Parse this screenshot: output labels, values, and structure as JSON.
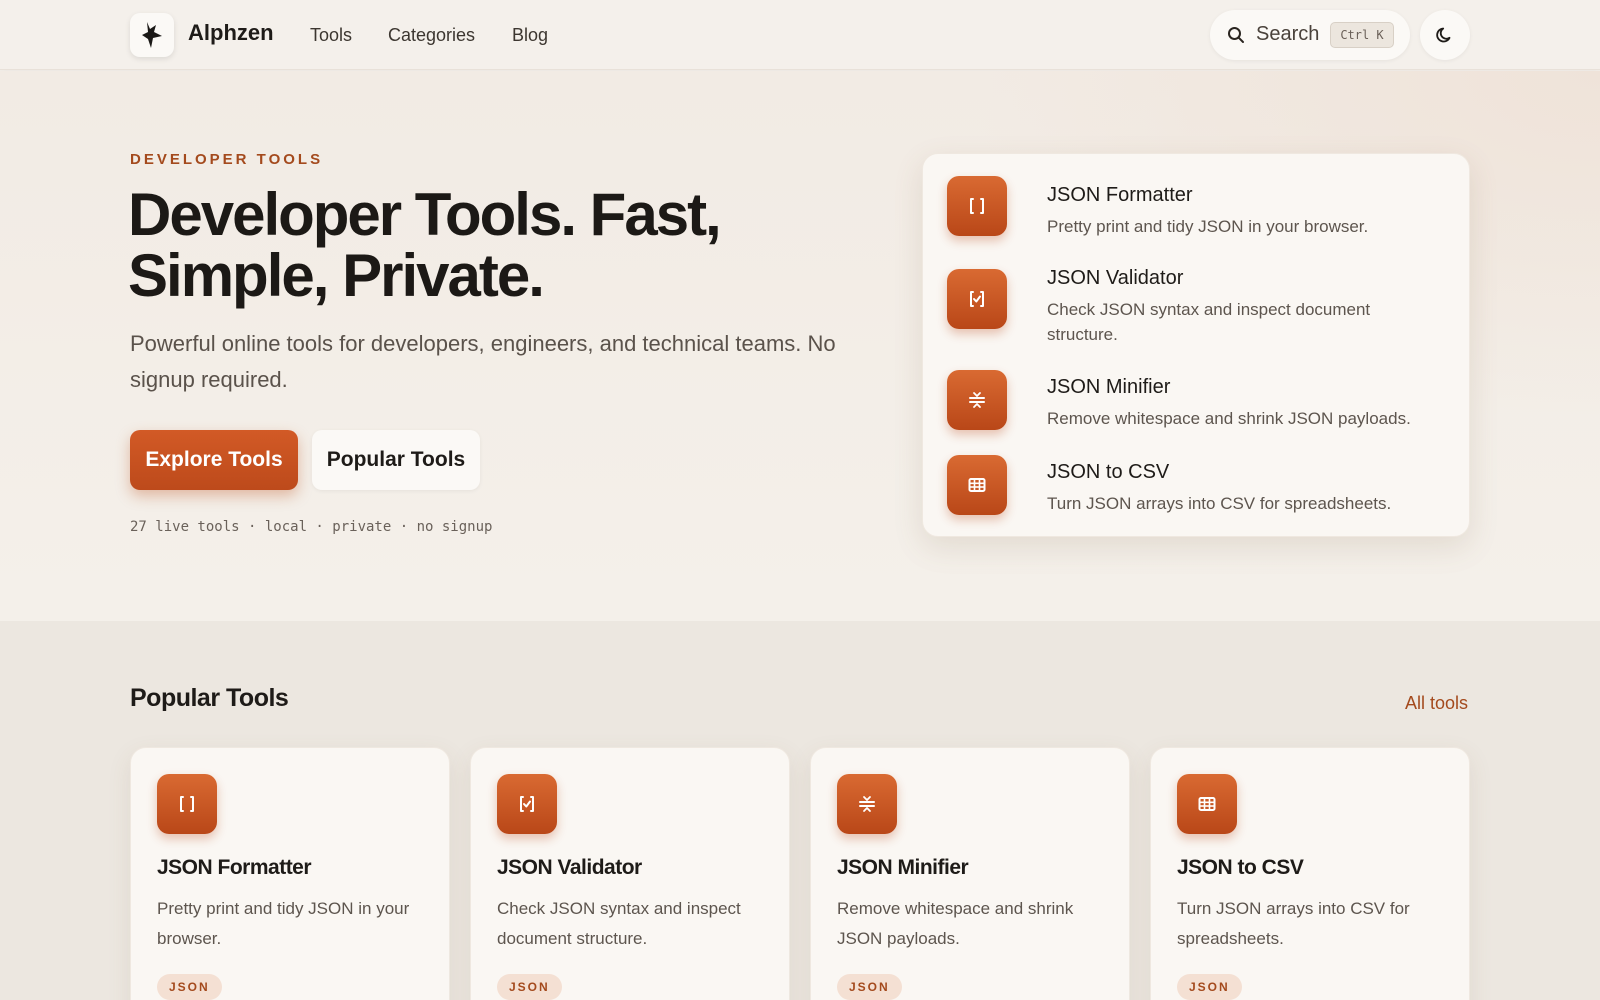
{
  "header": {
    "brand": "Alphzen",
    "nav": [
      "Tools",
      "Categories",
      "Blog"
    ],
    "search_label": "Search",
    "search_shortcut": "Ctrl K"
  },
  "hero": {
    "eyebrow": "DEVELOPER TOOLS",
    "headline_line1": "Developer Tools. Fast,",
    "headline_line2": "Simple, Private.",
    "subcopy": "Powerful online tools for developers, engineers, and technical teams. No signup required.",
    "primary_cta": "Explore Tools",
    "secondary_cta": "Popular Tools",
    "meta": "27 live tools · local · private · no signup"
  },
  "featured_tools": [
    {
      "title": "JSON Formatter",
      "description": "Pretty print and tidy JSON in your browser.",
      "icon": "brackets-icon"
    },
    {
      "title": "JSON Validator",
      "description": "Check JSON syntax and inspect document structure.",
      "icon": "check-icon"
    },
    {
      "title": "JSON Minifier",
      "description": "Remove whitespace and shrink JSON payloads.",
      "icon": "compress-icon"
    },
    {
      "title": "JSON to CSV",
      "description": "Turn JSON arrays into CSV for spreadsheets.",
      "icon": "table-icon"
    }
  ],
  "popular": {
    "title": "Popular Tools",
    "all_link": "All tools",
    "cards": [
      {
        "title": "JSON Formatter",
        "description": "Pretty print and tidy JSON in your browser.",
        "tag": "JSON",
        "icon": "brackets-icon"
      },
      {
        "title": "JSON Validator",
        "description": "Check JSON syntax and inspect document structure.",
        "tag": "JSON",
        "icon": "check-icon"
      },
      {
        "title": "JSON Minifier",
        "description": "Remove whitespace and shrink JSON payloads.",
        "tag": "JSON",
        "icon": "compress-icon"
      },
      {
        "title": "JSON to CSV",
        "description": "Turn JSON arrays into CSV for spreadsheets.",
        "tag": "JSON",
        "icon": "table-icon"
      }
    ]
  },
  "colors": {
    "accent": "#c4511f",
    "accent_text": "#a44a1d",
    "background": "#f3efea",
    "card": "#faf7f3"
  }
}
